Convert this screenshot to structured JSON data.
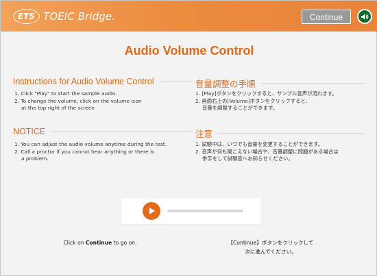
{
  "header": {
    "logo_mark": "ETS",
    "logo_text": "TOEIC Bridge.",
    "continue_label": "Continue",
    "accent_color": "#e9833a"
  },
  "title": "Audio Volume Control",
  "instructions_en": {
    "heading": "Instructions for Audio Volume Control",
    "items": [
      "1. Click \"Play\" to start the sample audio.",
      "2. To change the volume, click on the volume icon",
      "at the top right of the screen"
    ]
  },
  "instructions_ja": {
    "heading": "音量調整の手順",
    "items": [
      "1. [Play]ボタンをクリックすると、サンプル音声が流れます。",
      "2. 画面右上の[Volume]ボタンをクリックすると、",
      "音量を調整することができます。"
    ]
  },
  "notice_en": {
    "heading": "NOTICE",
    "items": [
      "1. You can adjust the audio volume anytime during the test.",
      "2. Call a proctor if you cannot hear anything or there is",
      "a problem."
    ]
  },
  "notice_ja": {
    "heading": "注意",
    "items": [
      "1. 試験中は、いつでも音量を変更することができます。",
      "2. 音声が何も聞こえない場合や、音量調整に問題がある場合は",
      "挙手をして試験官へお知らせください。"
    ]
  },
  "player": {
    "play_icon": "play-icon",
    "progress": 0
  },
  "footer": {
    "en_prefix": "Click on ",
    "en_bold": "Continue",
    "en_suffix": " to go on.",
    "ja_line1": "【Continue】ボタンをクリックして",
    "ja_line2": "次に進んでください。"
  }
}
